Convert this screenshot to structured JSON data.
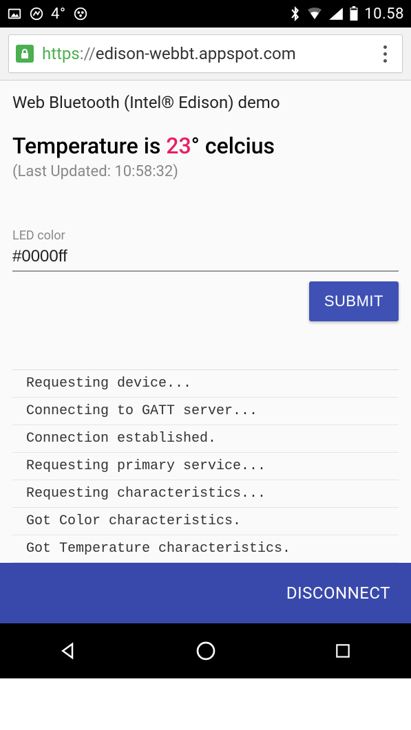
{
  "status": {
    "temperature": "4°",
    "clock": "10.58"
  },
  "browser": {
    "scheme": "https",
    "sep": "://",
    "host": "edison-webbt.appspot.com"
  },
  "page": {
    "title": "Web Bluetooth (Intel® Edison) demo",
    "temp_prefix": "Temperature is ",
    "temp_value": "23",
    "temp_suffix": "° celcius",
    "updated_prefix": "(Last Updated: ",
    "updated_time": "10:58:32",
    "updated_suffix": ")"
  },
  "form": {
    "label": "LED color",
    "value": "#0000ff",
    "submit": "SUBMIT"
  },
  "log": [
    "Requesting device...",
    "Connecting to GATT server...",
    "Connection established.",
    "Requesting primary service...",
    "Requesting characteristics...",
    "Got Color characteristics.",
    "Got Temperature characteristics."
  ],
  "footer": {
    "disconnect": "DISCONNECT"
  }
}
